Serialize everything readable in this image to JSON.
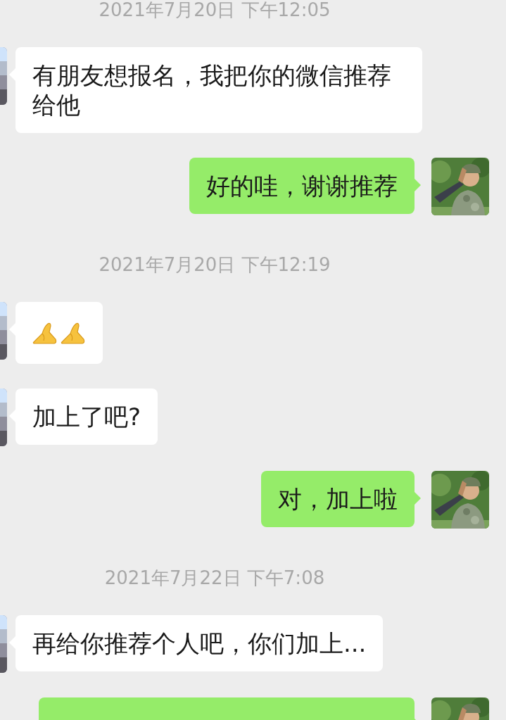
{
  "messages": [
    {
      "kind": "timestamp",
      "text": "2021年7月20日 下午12:05"
    },
    {
      "kind": "text",
      "sent": false,
      "text": "有朋友想报名，我把你的微信推荐给他"
    },
    {
      "kind": "text",
      "sent": true,
      "text": "好的哇，谢谢推荐"
    },
    {
      "kind": "timestamp",
      "text": "2021年7月20日 下午12:19"
    },
    {
      "kind": "emoji",
      "sent": false
    },
    {
      "kind": "text",
      "sent": false,
      "text": "加上了吧?"
    },
    {
      "kind": "text",
      "sent": true,
      "text": "对，加上啦"
    },
    {
      "kind": "timestamp",
      "text": "2021年7月22日 下午7:08"
    },
    {
      "kind": "text",
      "sent": false,
      "text": "再给你推荐个人吧，你们加上..."
    },
    {
      "kind": "cut",
      "sent": true
    }
  ]
}
